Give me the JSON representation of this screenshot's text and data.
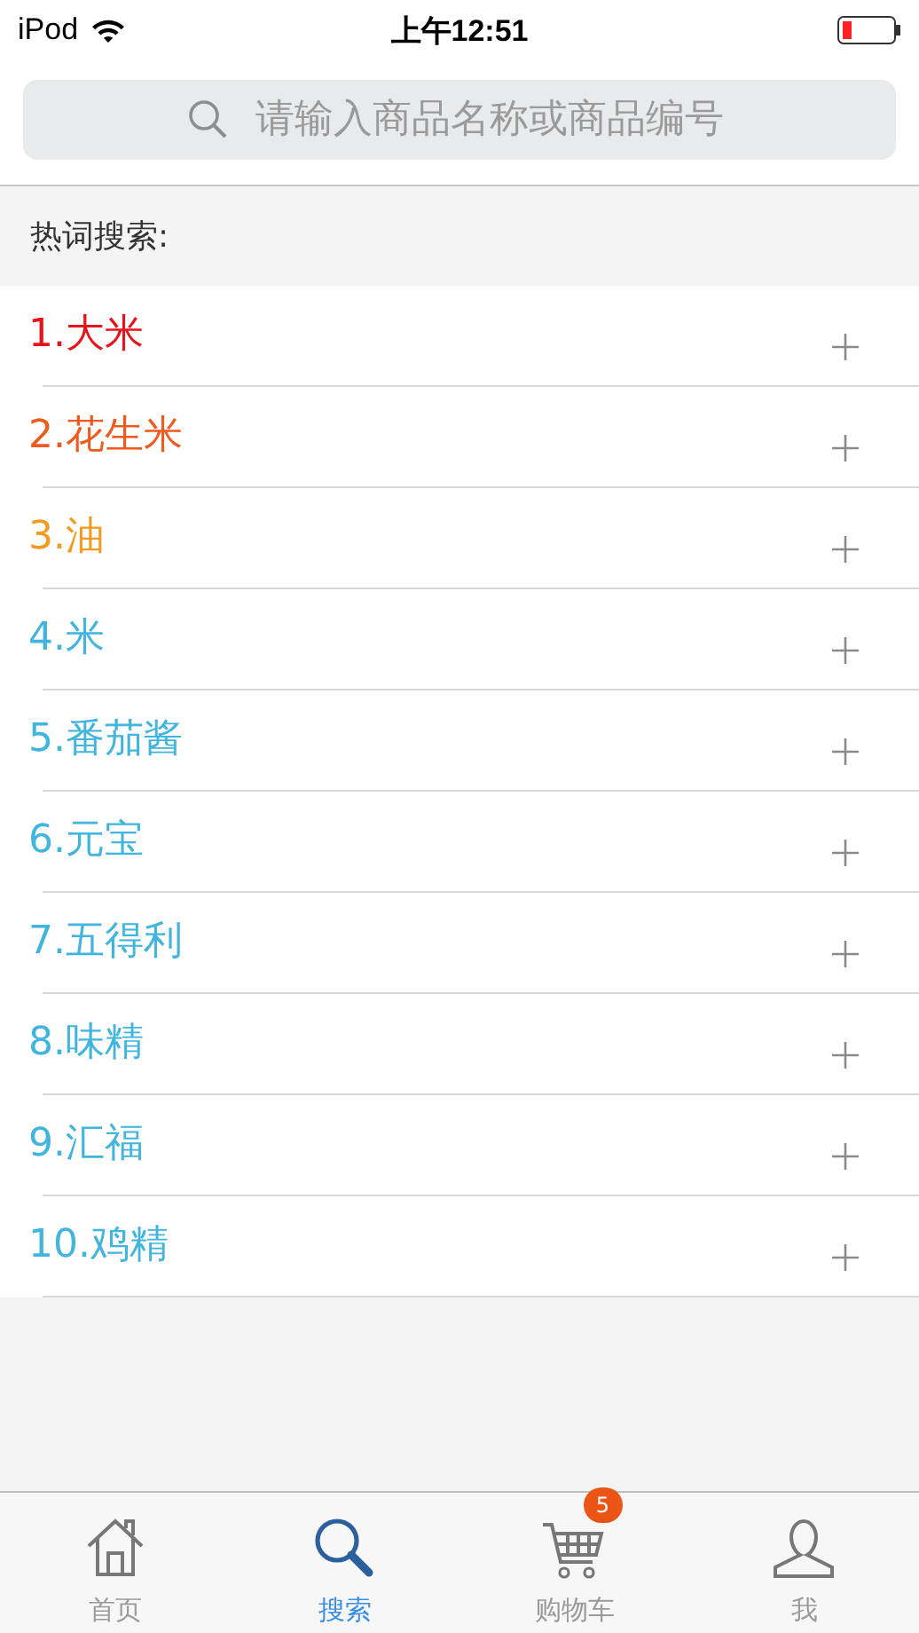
{
  "status_bar": {
    "carrier": "iPod",
    "time": "上午12:51"
  },
  "search": {
    "placeholder": "请输入商品名称或商品编号"
  },
  "hot_words": {
    "title": "热词搜索:",
    "items": [
      {
        "label": "1.大米",
        "color": "#e8141c"
      },
      {
        "label": "2.花生米",
        "color": "#ef5a1f"
      },
      {
        "label": "3.油",
        "color": "#f39a22"
      },
      {
        "label": "4.米",
        "color": "#42b5df"
      },
      {
        "label": "5.番茄酱",
        "color": "#42b5df"
      },
      {
        "label": "6.元宝",
        "color": "#42b5df"
      },
      {
        "label": "7.五得利",
        "color": "#42b5df"
      },
      {
        "label": "8.味精",
        "color": "#42b5df"
      },
      {
        "label": "9.汇福",
        "color": "#42b5df"
      },
      {
        "label": "10.鸡精",
        "color": "#42b5df"
      }
    ]
  },
  "tab_bar": [
    {
      "kind": "home",
      "label": "首页",
      "selected": false
    },
    {
      "kind": "search",
      "label": "搜索",
      "selected": true
    },
    {
      "kind": "cart",
      "label": "购物车",
      "selected": false,
      "badge": "5"
    },
    {
      "kind": "me",
      "label": "我",
      "selected": false
    }
  ]
}
